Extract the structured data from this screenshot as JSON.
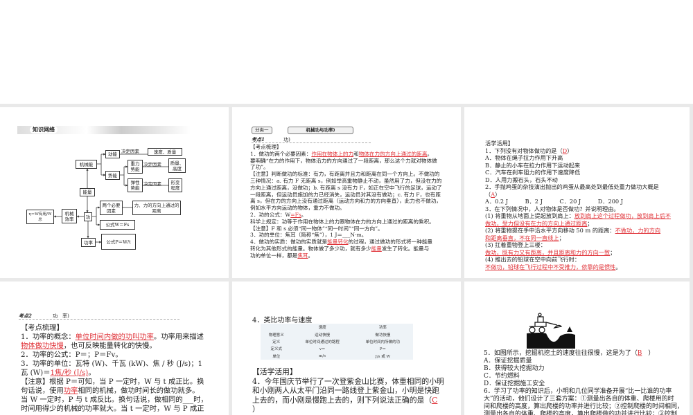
{
  "colors": {
    "answer": "#e0343a",
    "separator": "#e9e9e9"
  },
  "s1": {
    "header": "知识网络",
    "n": {
      "dongneng": "动能",
      "jd1": "决定因素",
      "sudu": "速度、质量",
      "jixieneng": "机械能",
      "zhongli": "重力势能",
      "jd2": "决定因素",
      "zhiliang": "质量、高度",
      "shineng": "势能",
      "tanxing": "弹性势能",
      "jd3": "决定因素",
      "xingbian": "形变程度",
      "nengliang": "能量",
      "liangge": "两个必要因素",
      "li": "力、力的方向上通过的距离",
      "gong": "功",
      "xiaolv": "机械效率",
      "eta": "η＝W有用/W总",
      "gsw": "公式W＝Fs",
      "gonglv": "功率",
      "gsp": "公式P＝W/t"
    }
  },
  "s2": {
    "tab1": "分类一",
    "tab2": "机械功与功率)",
    "kd": "考点1",
    "kdt": "功)",
    "lines": [
      [
        "【考点梳理】"
      ],
      [
        "1．做功的两个必要因素：",
        {
          "a": "作用在物体上的力"
        },
        "和",
        {
          "a": "物体在力的方向上通过的距离"
        },
        "。"
      ],
      [
        "要明确“在力的作用下，物体沿力的方向通过了一段距离，那么这个力就对物体做"
      ],
      [
        "了功”。"
      ],
      [
        "【注意】判断做功的标准：有力，有距离并且力和距离在同一个方向上。不做功的"
      ],
      [
        "三种情况：a. 有力 F 无距离 s，例如举高重物静止不动，虽然用了力，但没在力的"
      ],
      [
        "方向上通过距离，没做功；b. 有距离 s 没有力 F，如正在空中飞行的足球，运动了"
      ],
      [
        "一段距离，但运动员施加的力已经消失，运动员对其没有做功；c. 有力 F，也有距"
      ],
      [
        "离 s，但在力的方向上没有通过距离（运动方向和力的方向垂直），此力也不做功，"
      ],
      [
        "例如水平方向运动的物体，重力不做功。"
      ],
      [
        "2．功的公式：W",
        {
          "a": "=Fs"
        },
        "。"
      ],
      [
        "科学上规定：功等于作用在物体上的力跟物体在力的方向上通过的距离的乘积。"
      ],
      [
        "【注意】F 和 s 必须“同一物体”“同一时间”“同一方向”。"
      ],
      [
        "3．功的单位：焦耳（简称“焦”），1 J＝___N·m。"
      ],
      [
        "4．做功的实质：做功的实质就是",
        {
          "a": "能量转化"
        },
        "的过程，通过做功的形式将一种能量"
      ],
      [
        "转化为其他形式的能量。物体做了多少功，就有多少",
        {
          "a": "能量"
        },
        "发生了转化。能量与"
      ],
      [
        "功的单位一样，都是",
        {
          "a": "焦耳"
        },
        "。"
      ]
    ]
  },
  "s3": {
    "lines": [
      [
        "活学活用】"
      ],
      [
        "1．下列没有对物体做功的是（",
        {
          "a": "D"
        },
        "）"
      ],
      [
        "A．物体在绳子拉力作用下升高"
      ],
      [
        "B．静止的小车在拉力作用下运动起来"
      ],
      [
        "C．汽车在刹车阻力的作用下速度降低"
      ],
      [
        "D．人用力搬石头，石头不动"
      ],
      [
        "2．手抛鸡蛋的杂技演出抛出的鸡蛋从最高处到最低处重力做功大概是"
      ],
      [
        "（",
        {
          "a": "A"
        },
        "）"
      ],
      [
        "A．0.2 J　　　B．2 J　　　C．20 J　　　D．200 J"
      ],
      [
        "3．在下列情况中，人对物体是否做功？并说明理由。"
      ],
      [
        "(1) 将重物从地面上提起放到肩上：",
        {
          "a": "放到肩上这个过程做功，放到肩上后不"
        }
      ],
      [
        {
          "a": "做功，受力但没有在力的方向上通过距离"
        },
        "；"
      ],
      [
        "(2) 将重物提在手中沿水平方向移动 50 m 的距离：",
        {
          "a": "不做功，力的方向"
        }
      ],
      [
        {
          "a": "和距离垂直，不在同一直线上"
        },
        "；"
      ],
      [
        "(3) 扛着重物登上三楼："
      ],
      [
        {
          "a": "做功，既有力又有距离，并且距离和力的方向一致"
        },
        "；"
      ],
      [
        "(4) 推出去的铅球在空中向前飞行时："
      ],
      [
        {
          "a": "不做功，铅球在飞行过程中不受推力，依靠的是惯性"
        },
        "。"
      ]
    ]
  },
  "s4": {
    "kd": "考点2",
    "kdt": "功　率)",
    "lines": [
      [
        "【考点梳理】"
      ],
      [
        "1．功率的概念：",
        {
          "a": "单位时间内做的功叫功率"
        },
        "。功率用来描述"
      ],
      [
        {
          "a": "物体做功快慢"
        },
        "，也可反映能量转化的快慢。"
      ],
      [
        "2．功率的公式：P＝；P＝Fv。"
      ],
      [
        "3．功率的单位：瓦特 (W)、千瓦 (kW)、焦 / 秒 (J/s)；1"
      ],
      [
        "瓦 (W)＝",
        {
          "a": "1焦/秒 (J/s)"
        },
        "。"
      ],
      [
        "【注意】根据 P＝可知，当 P 一定时，W 与 t 成正比。换"
      ],
      [
        "句话说，使用",
        {
          "a": "功率"
        },
        "相同的机械，做功时间长的做功就多。"
      ],
      [
        "当 W 一定时，P 与 t 成反比。换句话说，做相同的___时，"
      ],
      [
        "时间用得少的机械的功率就大。当 t 一定时，W 与 P 成正"
      ]
    ]
  },
  "s5": {
    "title": "4．类比功率与速度",
    "table": [
      [
        "",
        "速度",
        "功率"
      ],
      [
        "物理意义",
        "运动快慢",
        "做功快慢"
      ],
      [
        "定义",
        "单位时间通过的路程",
        "单位时间内所做的功"
      ],
      [
        "定义式",
        "v＝",
        "P＝"
      ],
      [
        "单位",
        "m/s",
        "J/s 或 W"
      ]
    ],
    "lines": [
      [
        "【活学活用】"
      ],
      [
        "4．今年国庆节举行了一次登紫金山比赛，体重相同的小明"
      ],
      [
        "和小刚两人从太平门沿同一路线登上紫金山，小明是快跑"
      ],
      [
        "上去的，而小刚是慢跑上去的，则下列说法正确的是（",
        {
          "a": "C"
        }
      ],
      [
        "）"
      ]
    ]
  },
  "s6": {
    "lines": [
      [
        "5．如图所示，挖掘机挖土的速度往往很慢，这是为了（",
        {
          "a": "B"
        },
        "　）"
      ],
      [
        "A．保证挖掘质量"
      ],
      [
        "B．获得较大挖掘动力"
      ],
      [
        "C．节约燃料"
      ],
      [
        "D．保证挖掘施工安全"
      ],
      [
        "6．学习了功率的知识后，小明和几位同学准备开展“比一比谁的功率"
      ],
      [
        "大”的活动，他们设计了三套方案：①测量出各自的体重、爬楼用的时"
      ],
      [
        "间和爬楼的高度，算出爬楼的功率并进行比较；②控制爬楼的时间相同，"
      ],
      [
        "测量出各自的体重、爬楼的高度，算出爬楼做的功并进行比较；③控制"
      ]
    ]
  }
}
